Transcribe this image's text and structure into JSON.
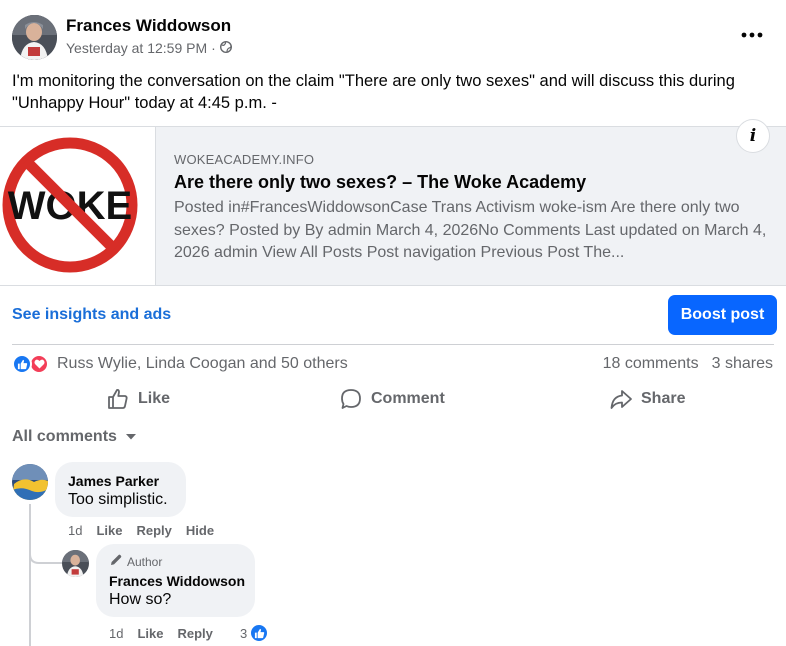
{
  "post": {
    "author": "Frances Widdowson",
    "time": "Yesterday at 12:59 PM",
    "separator": "·",
    "text": "I'm monitoring the conversation on the claim \"There are only two sexes\" and will discuss this during \"Unhappy Hour\" today at 4:45 p.m. -"
  },
  "link_preview": {
    "image_text": "WOKE",
    "domain": "WOKEACADEMY.INFO",
    "title": "Are there only two sexes? – The Woke Academy",
    "description": "Posted in#FrancesWiddowsonCase Trans Activism woke-ism Are there only two sexes? Posted by By admin March 4, 2026No Comments Last updated on March 4, 2026 admin View All Posts Post navigation Previous Post The..."
  },
  "insights": {
    "link_label": "See insights and ads",
    "boost_label": "Boost post"
  },
  "engagement": {
    "reactors": "Russ Wylie, Linda Coogan and 50 others",
    "comments": "18 comments",
    "shares": "3 shares"
  },
  "actions": {
    "like": "Like",
    "comment": "Comment",
    "share": "Share"
  },
  "comments_filter": "All comments",
  "comments": [
    {
      "name": "James Parker",
      "text": "Too simplistic.",
      "time": "1d",
      "like": "Like",
      "reply": "Reply",
      "hide": "Hide"
    }
  ],
  "reply": {
    "badge": "Author",
    "name": "Frances Widdowson",
    "text": "How so?",
    "time": "1d",
    "like": "Like",
    "reply": "Reply",
    "reaction_count": "3"
  },
  "colors": {
    "accent": "#0866ff",
    "link": "#1a6ed8",
    "secondary_text": "#65676b",
    "like_blue": "#1877f2",
    "love_red": "#f33e58"
  }
}
